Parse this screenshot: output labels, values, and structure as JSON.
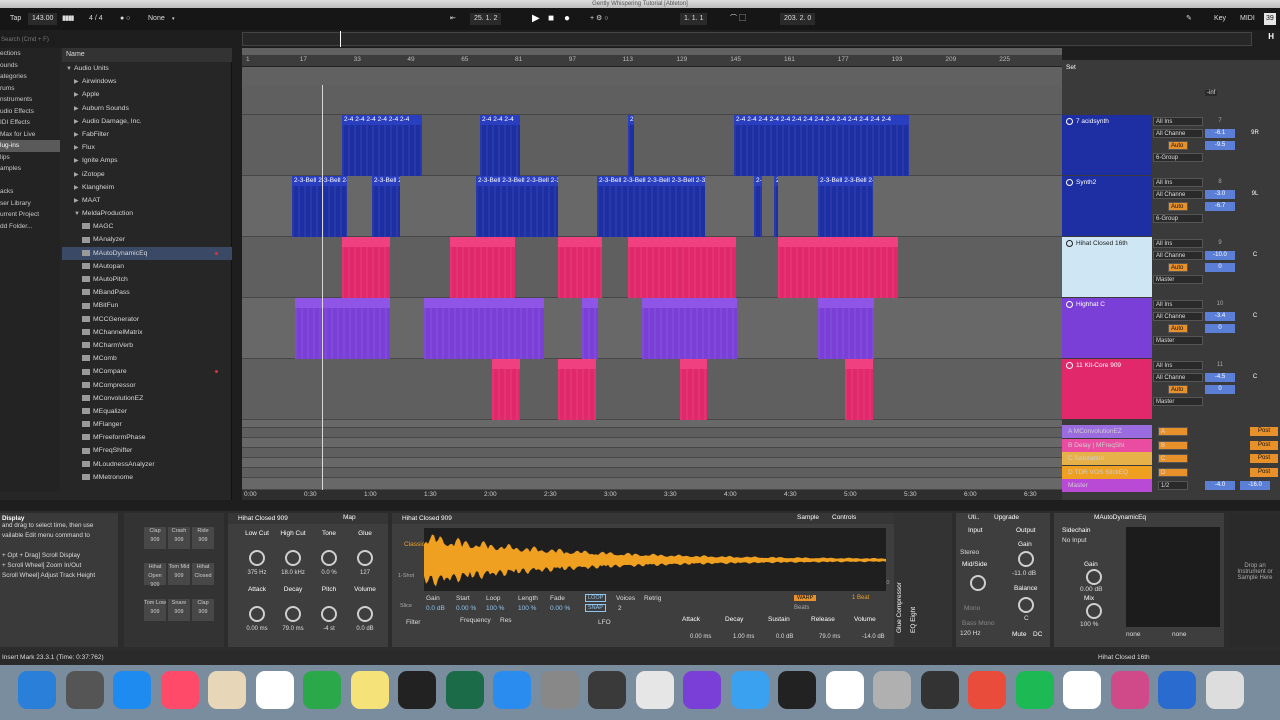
{
  "window_title": "Gently Whispering Tutorial  [Ableton]",
  "toolbar": {
    "tap": "Tap",
    "tempo": "143.00",
    "signature": "4 / 4",
    "quantize": "None",
    "position": "25.  1.  2",
    "loop_start": "1.  1.  1",
    "loop_length": "203.  2.  0",
    "key": "Key",
    "midi": "MIDI",
    "cpu": "39"
  },
  "overview": {
    "h_label": "H"
  },
  "browser": {
    "search_placeholder": "Search (Cmd + F)",
    "categories": [
      "ections",
      "ounds",
      "ategories",
      "rums",
      "nstruments",
      "udio Effects",
      "IDI Effects",
      "Max for Live",
      "lug-ins",
      "lips",
      "amples",
      "",
      "acks",
      "ser Library",
      "urrent Project",
      "dd Folder..."
    ],
    "tree_header": "Name",
    "tree": [
      {
        "label": "Audio Units",
        "indent": 0,
        "open": true,
        "folder": false
      },
      {
        "label": "Airwindows",
        "indent": 1,
        "open": false,
        "folder": false
      },
      {
        "label": "Apple",
        "indent": 1,
        "open": false,
        "folder": false
      },
      {
        "label": "Auburn Sounds",
        "indent": 1,
        "open": false,
        "folder": false
      },
      {
        "label": "Audio Damage, Inc.",
        "indent": 1,
        "open": false,
        "folder": false
      },
      {
        "label": "FabFilter",
        "indent": 1,
        "open": false,
        "folder": false
      },
      {
        "label": "Flux",
        "indent": 1,
        "open": false,
        "folder": false
      },
      {
        "label": "Ignite Amps",
        "indent": 1,
        "open": false,
        "folder": false
      },
      {
        "label": "iZotope",
        "indent": 1,
        "open": false,
        "folder": false
      },
      {
        "label": "Klangheim",
        "indent": 1,
        "open": false,
        "folder": false
      },
      {
        "label": "MAAT",
        "indent": 1,
        "open": false,
        "folder": false
      },
      {
        "label": "MeldaProduction",
        "indent": 1,
        "open": true,
        "folder": false
      },
      {
        "label": "MAGC",
        "indent": 2,
        "folder": true
      },
      {
        "label": "MAnalyzer",
        "indent": 2,
        "folder": true
      },
      {
        "label": "MAutoDynamicEq",
        "indent": 2,
        "folder": true,
        "selected": true,
        "dot": true
      },
      {
        "label": "MAutopan",
        "indent": 2,
        "folder": true
      },
      {
        "label": "MAutoPitch",
        "indent": 2,
        "folder": true
      },
      {
        "label": "MBandPass",
        "indent": 2,
        "folder": true
      },
      {
        "label": "MBitFun",
        "indent": 2,
        "folder": true
      },
      {
        "label": "MCCGenerator",
        "indent": 2,
        "folder": true
      },
      {
        "label": "MChannelMatrix",
        "indent": 2,
        "folder": true
      },
      {
        "label": "MCharmVerb",
        "indent": 2,
        "folder": true
      },
      {
        "label": "MComb",
        "indent": 2,
        "folder": true
      },
      {
        "label": "MCompare",
        "indent": 2,
        "folder": true,
        "dot": true
      },
      {
        "label": "MCompressor",
        "indent": 2,
        "folder": true
      },
      {
        "label": "MConvolutionEZ",
        "indent": 2,
        "folder": true
      },
      {
        "label": "MEqualizer",
        "indent": 2,
        "folder": true
      },
      {
        "label": "MFlanger",
        "indent": 2,
        "folder": true
      },
      {
        "label": "MFreeformPhase",
        "indent": 2,
        "folder": true
      },
      {
        "label": "MFreqShifter",
        "indent": 2,
        "folder": true
      },
      {
        "label": "MLoudnessAnalyzer",
        "indent": 2,
        "folder": true
      },
      {
        "label": "MMetronome",
        "indent": 2,
        "folder": true
      }
    ]
  },
  "ruler": [
    "1",
    "17",
    "33",
    "49",
    "65",
    "81",
    "97",
    "113",
    "129",
    "145",
    "161",
    "177",
    "193",
    "209",
    "225"
  ],
  "timeline": [
    "0:00",
    "0:30",
    "1:00",
    "1:30",
    "2:00",
    "2:30",
    "3:00",
    "3:30",
    "4:00",
    "4:30",
    "5:00",
    "5:30",
    "6:00",
    "6:30"
  ],
  "tracks": [
    {
      "name": "7 acidsynth",
      "color": "#1d2fa3",
      "input": "All Ins",
      "channel": "All Channe",
      "route": "6-Group",
      "vol": "-6.1",
      "pan": "9R",
      "send": "-9.5",
      "number": "7"
    },
    {
      "name": "Synth2",
      "color": "#1d2fa3",
      "input": "All Ins",
      "channel": "All Channe",
      "route": "6-Group",
      "vol": "-3.0",
      "pan": "9L",
      "send": "-6.7",
      "number": "8"
    },
    {
      "name": "Hihat Closed 16th",
      "color": "#cfe6f5",
      "input": "All Ins",
      "channel": "All Channe",
      "route": "Master",
      "vol": "-10.0",
      "pan": "C",
      "send": "0",
      "number": "9"
    },
    {
      "name": "Highhat C",
      "color": "#7a3fd6",
      "input": "All Ins",
      "channel": "All Channe",
      "route": "Master",
      "vol": "-3.4",
      "pan": "C",
      "send": "0",
      "number": "10"
    },
    {
      "name": "11 Kit-Core 909",
      "color": "#e0286b",
      "input": "All Ins",
      "channel": "All Channe",
      "route": "Master",
      "vol": "-4.5",
      "pan": "C",
      "send": "0",
      "number": "11"
    }
  ],
  "mixer_top": {
    "set": "Set",
    "inf": "-inf"
  },
  "returns": [
    {
      "name": "A MConvolutionEZ",
      "letter": "A",
      "color": "#9b6be0"
    },
    {
      "name": "B Delay | MFreqShi",
      "letter": "B",
      "color": "#e94ca0"
    },
    {
      "name": "C Saturation",
      "letter": "C",
      "color": "#e7b14a"
    },
    {
      "name": "D TDR VOS SlickEQ",
      "letter": "D",
      "color": "#f0a020"
    },
    {
      "name": "Master",
      "letter": "1/2",
      "color": "#b84ad6"
    }
  ],
  "master": {
    "vol": "-4.0",
    "pan": "-16.0",
    "post": "Post"
  },
  "clip_labels": {
    "acid": "2-4",
    "synth2": "2-3-Bell"
  },
  "detail": {
    "info_title": "Display",
    "info_lines": [
      "and drag to select time, then use",
      "vailable Edit menu command to",
      "",
      "+ Opt + Drag] Scroll Display",
      "+ Scroll Wheel] Zoom In/Out",
      "Scroll Wheel] Adjust Track Height"
    ],
    "drum_pads": [
      "Clap 909",
      "Crash 909",
      "Ride 909",
      "Hihat Open 909",
      "Tom Mid 909",
      "Hihat Closed",
      "Tom Low 909",
      "Snare 909",
      "Clap 909"
    ],
    "device1": {
      "name": "Hihat Closed 909",
      "map": "Map",
      "knobs": [
        {
          "label": "Low Cut",
          "value": "375 Hz"
        },
        {
          "label": "High Cut",
          "value": "18.0 kHz"
        },
        {
          "label": "Tone",
          "value": "0.0 %"
        },
        {
          "label": "Glue",
          "value": "127"
        },
        {
          "label": "Attack",
          "value": "0.00 ms"
        },
        {
          "label": "Decay",
          "value": "79.0 ms"
        },
        {
          "label": "Pitch",
          "value": "-4 st"
        },
        {
          "label": "Volume",
          "value": "0.0 dB"
        }
      ]
    },
    "sampler": {
      "name": "Hihat Closed 909",
      "sample": "Sample",
      "controls": "Controls",
      "mode": "Classic",
      "shot": "1-Shot",
      "slice": "Slice",
      "gain_label": "Gain",
      "start_label": "Start",
      "loop_label": "Loop",
      "length_label": "Length",
      "fade_label": "Fade",
      "gain": "0.0 dB",
      "start": "0.00 %",
      "loop": "100 %",
      "length": "100 %",
      "fade": "0.00 %",
      "loop_btn": "LOOP",
      "snap_btn": "SNAP",
      "voices_label": "Voices",
      "voices": "2",
      "retrig": "Retrig",
      "warp": "WARP",
      "beats": "Beats",
      "beat_val": "1 Beat",
      "filter": "Filter",
      "freq": "Frequency",
      "res": "Res",
      "lfo": "LFO",
      "env_labels": [
        "Attack",
        "Decay",
        "Sustain",
        "Release",
        "Volume"
      ],
      "env_values": [
        "0.00 ms",
        "1.00 ms",
        "0.0 dB",
        "79.0 ms",
        "-14.0 dB"
      ],
      "time_marks": [
        "0:00:050",
        "0:00:100",
        "0:00:150"
      ]
    },
    "fx_labels": [
      "Glue Compressor",
      "EQ Eight"
    ],
    "utility": {
      "name": "Uti..",
      "upgrade": "Upgrade",
      "input": "Input",
      "output": "Output",
      "stereo": "Stereo",
      "width": "Mid/Side",
      "gain_label": "Gain",
      "gain": "-11.0 dB",
      "balance": "Balance",
      "bal": "C",
      "mono": "Mono",
      "bass": "Bass Mono",
      "hz": "120 Hz",
      "mute": "Mute",
      "dc": "DC"
    },
    "dyn": {
      "name": "MAutoDynamicEq",
      "sidechain": "Sidechain",
      "no_input": "No Input",
      "gain": "Gain",
      "gain_val": "0.00 dB",
      "mix": "Mix",
      "mix_val": "100 %",
      "none1": "none",
      "none2": "none"
    },
    "dropzone": "Drop an Instrument or Sample Here"
  },
  "status": {
    "left": "Insert Mark 23.3.1 (Time: 0:37:762)",
    "right": "Hihat Closed 16th"
  }
}
